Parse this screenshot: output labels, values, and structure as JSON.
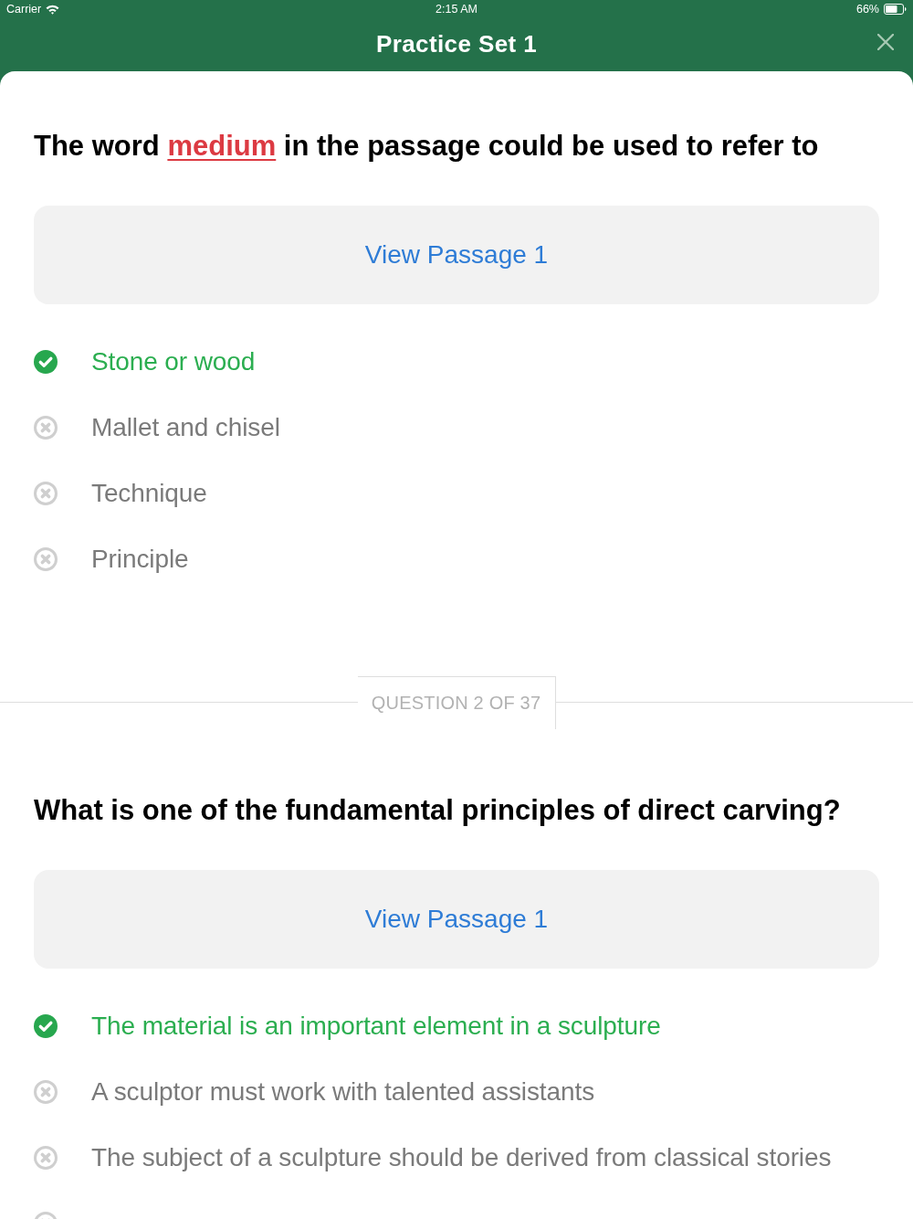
{
  "status_bar": {
    "carrier": "Carrier",
    "time": "2:15 AM",
    "battery": "66%"
  },
  "header": {
    "title": "Practice Set 1"
  },
  "sections": [
    {
      "kind": "question",
      "parts": [
        {
          "text": "The word ",
          "highlighted": false
        },
        {
          "text": "medium",
          "highlighted": true
        },
        {
          "text": " in the passage could be used to refer to",
          "highlighted": false
        }
      ],
      "passage_button": "View Passage 1",
      "answers": [
        {
          "label": "Stone or wood",
          "correct": true
        },
        {
          "label": "Mallet and chisel",
          "correct": false
        },
        {
          "label": "Technique",
          "correct": false
        },
        {
          "label": "Principle",
          "correct": false
        }
      ]
    },
    {
      "kind": "divider",
      "label": "QUESTION 2 OF 37"
    },
    {
      "kind": "question",
      "parts": [
        {
          "text": "What is one of the fundamental principles of direct carving?",
          "highlighted": false
        }
      ],
      "passage_button": "View Passage 1",
      "answers": [
        {
          "label": "The material is an important element in a sculpture",
          "correct": true
        },
        {
          "label": "A sculptor must work with talented assistants",
          "correct": false
        },
        {
          "label": "The subject of a sculpture should be derived from classical stories",
          "correct": false
        },
        {
          "correct": false
        }
      ]
    }
  ]
}
